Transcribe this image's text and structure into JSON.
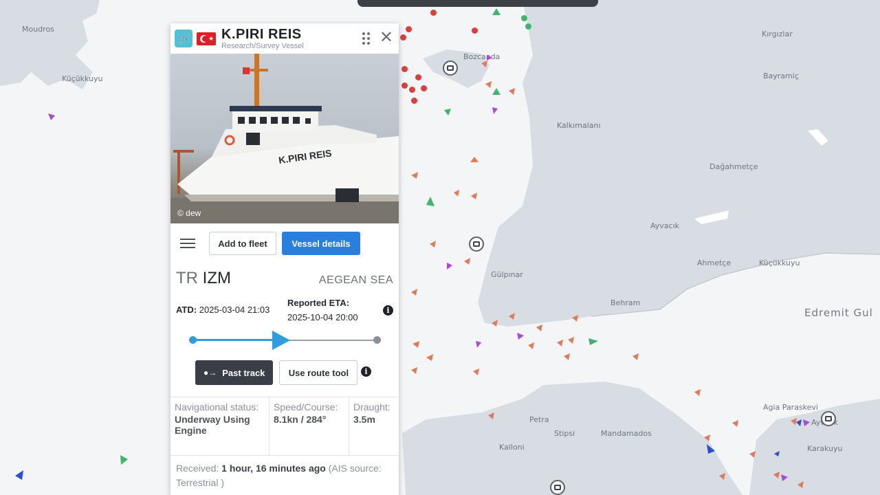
{
  "map": {
    "places": [
      {
        "id": "moudros",
        "label": "Moudros"
      },
      {
        "id": "kucukkuyu-top",
        "label": "Küçükkuyu"
      },
      {
        "id": "bozcaada",
        "label": "Bozcaada"
      },
      {
        "id": "bayramic",
        "label": "Bayramiç"
      },
      {
        "id": "kirgizlar",
        "label": "Kırgızlar"
      },
      {
        "id": "kalkimalani",
        "label": "Kalkımalanı"
      },
      {
        "id": "dagahmetce",
        "label": "Dağahmetçe"
      },
      {
        "id": "ayvacik",
        "label": "Ayvacık"
      },
      {
        "id": "ahmetce",
        "label": "Ahmetçe"
      },
      {
        "id": "kucukkuyu",
        "label": "Küçükkuyu"
      },
      {
        "id": "gulpinar",
        "label": "Gülpınar"
      },
      {
        "id": "behram",
        "label": "Behram"
      },
      {
        "id": "edremit",
        "label": "Edremit Gul"
      },
      {
        "id": "petra",
        "label": "Petra"
      },
      {
        "id": "stipsi",
        "label": "Stipsi"
      },
      {
        "id": "mandamados",
        "label": "Mandamados"
      },
      {
        "id": "kalloni",
        "label": "Kalloni"
      },
      {
        "id": "ayvalik",
        "label": "Ayvalık"
      },
      {
        "id": "paraskevi",
        "label": "Agia Paraskevi"
      },
      {
        "id": "karakuyu",
        "label": "Karakuyu"
      }
    ],
    "colors": {
      "sea": "#f4f5f7",
      "land": "#d7dde3",
      "cargo": "#e07b5a",
      "tanker": "#c8405a",
      "passenger": "#a94bd6",
      "fishing": "#3fb56c"
    }
  },
  "panel": {
    "vessel_name": "K.PIRI REIS",
    "vessel_type": "Research/Survey Vessel",
    "flag": "Turkey",
    "photo_credit": "© dew",
    "photo_caption": "K.PIRI REIS",
    "add_to_fleet": "Add to fleet",
    "vessel_details": "Vessel details",
    "origin_country": "TR",
    "origin_port": "IZM",
    "destination": "AEGEAN SEA",
    "atd_label": "ATD:",
    "atd_value": "2025-03-04 21:03",
    "eta_label": "Reported ETA:",
    "eta_value": "2025-10-04 20:00",
    "voyage_progress": 0.5,
    "past_track": "Past track",
    "route_tool": "Use route tool",
    "stats": {
      "nav_status_label": "Navigational status:",
      "nav_status_value": "Underway Using Engine",
      "speed_label": "Speed/Course:",
      "speed_value": "8.1kn / 284°",
      "draught_label": "Draught:",
      "draught_value": "3.5m"
    },
    "received_label": "Received:",
    "received_value": "1 hour, 16 minutes ago",
    "ais_source": "(AIS source: Terrestrial )"
  },
  "icons": [
    "link-icon",
    "turkey-flag-icon",
    "drag-handle-icon",
    "close-icon",
    "menu-icon",
    "info-icon",
    "track-icon"
  ]
}
